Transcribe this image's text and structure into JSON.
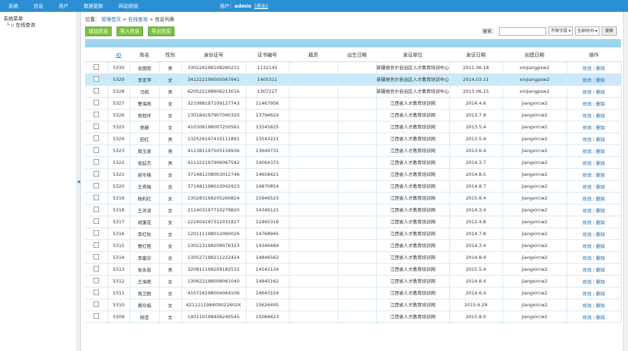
{
  "topbar": {
    "nav": [
      "系统",
      "信息",
      "用户",
      "数据更新",
      "网站频道"
    ],
    "user_label": "用户：",
    "user_name": "admin",
    "logout": "[退出]"
  },
  "sidebar": {
    "root": "系统菜单",
    "child": "在线查询"
  },
  "breadcrumb": {
    "prefix": "位置：",
    "crumb1": "管理首页",
    "sep": ">",
    "crumb2": "在线查询",
    "crumb3": "信息列表"
  },
  "toolbar": {
    "add": "增加信息",
    "import": "导入信息",
    "export": "导出信息",
    "search_label": "搜索：",
    "select1": "不限字段",
    "select2": "全部时间",
    "search_button": "搜索"
  },
  "table": {
    "headers": [
      "",
      "ID",
      "姓名",
      "性别",
      "身份证号",
      "证书编号",
      "籍贯",
      "出生日期",
      "发证单位",
      "发证日期",
      "创建日期",
      "操作"
    ],
    "edit": "修改",
    "delete": "删除",
    "rows": [
      [
        "5330",
        "余国阳",
        "男",
        "330226198108260231",
        "1132145",
        "",
        "",
        "新疆维吾尔自治区人才教育培训中心",
        "2011.06.18",
        "xinjiangpxw2"
      ],
      [
        "5329",
        "李亚萍",
        "女",
        "341222199005067941",
        "1405311",
        "",
        "",
        "新疆维吾尔自治区人才教育培训中心",
        "2014.03.11",
        "xinjiangpxw2"
      ],
      [
        "5328",
        "马帆",
        "男",
        "620525198606213016",
        "1307227",
        "",
        "",
        "新疆维吾尔自治区人才教育培训中心",
        "2013.06.15",
        "xinjiangpxw2"
      ],
      [
        "5327",
        "曹海燕",
        "女",
        "321088197109127743",
        "11467956",
        "",
        "",
        "江西省人才教育培训网",
        "2014.4.6",
        "jiangxircw2"
      ],
      [
        "5326",
        "吴程环",
        "女",
        "130184197907090320",
        "13794624",
        "",
        "",
        "江西省人才教育培训网",
        "2013.7.9",
        "jiangxircw2"
      ],
      [
        "5325",
        "吴静",
        "女",
        "410306198007250561",
        "13545625",
        "",
        "",
        "江西省人才教育培训网",
        "2013.5.4",
        "jiangxircw2"
      ],
      [
        "5324",
        "田红",
        "男",
        "132526197410111891",
        "13543221",
        "",
        "",
        "江西省人才教育培训网",
        "2013.5.4",
        "jiangxircw2"
      ],
      [
        "5323",
        "周玉泉",
        "男",
        "411381197505159936",
        "13649731",
        "",
        "",
        "江西省人才教育培训网",
        "2013.6.4",
        "jiangxircw2"
      ],
      [
        "5322",
        "张延杰",
        "男",
        "411322197906067542",
        "14064373",
        "",
        "",
        "江西省人才教育培训网",
        "2014.3.7",
        "jiangxircw2"
      ],
      [
        "5321",
        "梁冬梅",
        "女",
        "371481108003012746",
        "14658421",
        "",
        "",
        "江西省人才教育培训网",
        "2014.8.5",
        "jiangxircw2"
      ],
      [
        "5320",
        "王秀梅",
        "女",
        "371481198010042923",
        "14870854",
        "",
        "",
        "江西省人才教育培训网",
        "2014.8.7",
        "jiangxircw2"
      ],
      [
        "5319",
        "杨利红",
        "女",
        "130283198205260824",
        "15946523",
        "",
        "",
        "江西省人才教育培训网",
        "2015.8.4",
        "jiangxircw2"
      ],
      [
        "5318",
        "王洪涛",
        "女",
        "211403197710279820",
        "14346121",
        "",
        "",
        "江西省人才教育培训网",
        "2014.3.4",
        "jiangxircw2"
      ],
      [
        "5317",
        "胡蓬花",
        "女",
        "222404197311031827",
        "12465316",
        "",
        "",
        "江西省人才教育培训网",
        "2012.4.8",
        "jiangxircw2"
      ],
      [
        "5316",
        "李红秋",
        "女",
        "120111198012060026",
        "14768945",
        "",
        "",
        "江西省人才教育培训网",
        "2014.7.8",
        "jiangxircw2"
      ],
      [
        "5315",
        "曹红艳",
        "女",
        "130223198209076323",
        "14346484",
        "",
        "",
        "江西省人才教育培训网",
        "2014.3.4",
        "jiangxircw2"
      ],
      [
        "5314",
        "李建芬",
        "女",
        "130527198211222424",
        "14846562",
        "",
        "",
        "江西省人才教育培训网",
        "2014.8.4",
        "jiangxircw2"
      ],
      [
        "5313",
        "张永俊",
        "男",
        "320811198209182532",
        "14542134",
        "",
        "",
        "江西省人才教育培训网",
        "2015.5.4",
        "jiangxircw2"
      ],
      [
        "5312",
        "王海艳",
        "女",
        "130622198008061040",
        "14845162",
        "",
        "",
        "江西省人才教育培训网",
        "2014.8.4",
        "jiangxircw2"
      ],
      [
        "5311",
        "周卫群",
        "女",
        "410726198004064106",
        "14643154",
        "",
        "",
        "江西省人才教育培训网",
        "2014.6.4",
        "jiangxircw2"
      ],
      [
        "5310",
        "黄玲娟",
        "女",
        "421121198409021602X",
        "15626495",
        "",
        "",
        "江西省人才教育培训网",
        "2015.6.29",
        "jiangxircw2"
      ],
      [
        "5309",
        "杨莹",
        "女",
        "140110198406240545",
        "15084623",
        "",
        "",
        "江西省人才教育培训网",
        "2015.8.0",
        "jiangxircw2"
      ]
    ]
  }
}
